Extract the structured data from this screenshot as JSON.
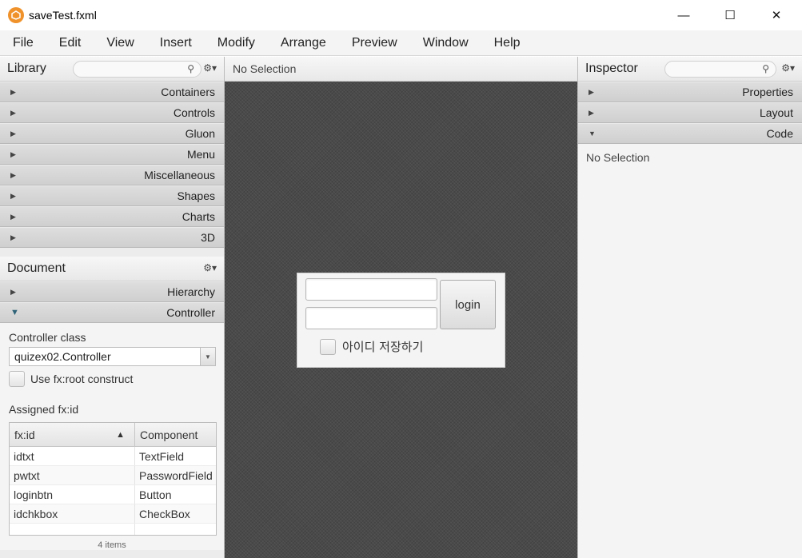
{
  "window": {
    "title": "saveTest.fxml",
    "minimize_glyph": "—",
    "maximize_glyph": "☐",
    "close_glyph": "✕"
  },
  "menubar": {
    "items": [
      "File",
      "Edit",
      "View",
      "Insert",
      "Modify",
      "Arrange",
      "Preview",
      "Window",
      "Help"
    ]
  },
  "library": {
    "title": "Library",
    "search_placeholder": "",
    "sections": [
      "Containers",
      "Controls",
      "Gluon",
      "Menu",
      "Miscellaneous",
      "Shapes",
      "Charts",
      "3D"
    ]
  },
  "document": {
    "title": "Document",
    "sections": [
      {
        "label": "Hierarchy",
        "expanded": false
      },
      {
        "label": "Controller",
        "expanded": true
      }
    ],
    "controller_class_label": "Controller class",
    "controller_class_value": "quizex02.Controller",
    "use_root_label": "Use fx:root construct",
    "assigned_label": "Assigned fx:id",
    "table": {
      "headers": [
        "fx:id",
        "Component"
      ],
      "rows": [
        [
          "idtxt",
          "TextField"
        ],
        [
          "pwtxt",
          "PasswordField"
        ],
        [
          "loginbtn",
          "Button"
        ],
        [
          "idchkbox",
          "CheckBox"
        ]
      ]
    },
    "items_count": "4 items"
  },
  "center": {
    "selection_text": "No Selection",
    "form": {
      "login_button_label": "login",
      "checkbox_label": "아이디 저장하기"
    }
  },
  "inspector": {
    "title": "Inspector",
    "search_placeholder": "",
    "sections": [
      {
        "label": "Properties",
        "expanded": false
      },
      {
        "label": "Layout",
        "expanded": false
      },
      {
        "label": "Code",
        "expanded": true
      }
    ],
    "empty_text": "No Selection"
  },
  "colors": {
    "canvas_bg": "#4a4a4a",
    "panel_bg": "#ececec",
    "logo_accent": "#f0922b",
    "expanded_triangle": "#2f6478"
  },
  "icons": {
    "app": "scene-builder-logo-icon",
    "search": "search-icon",
    "gear": "gear-icon",
    "collapsed": "triangle-right-icon",
    "expanded": "triangle-down-icon",
    "sort": "sort-ascending-icon",
    "dropdown": "chevron-down-icon"
  }
}
